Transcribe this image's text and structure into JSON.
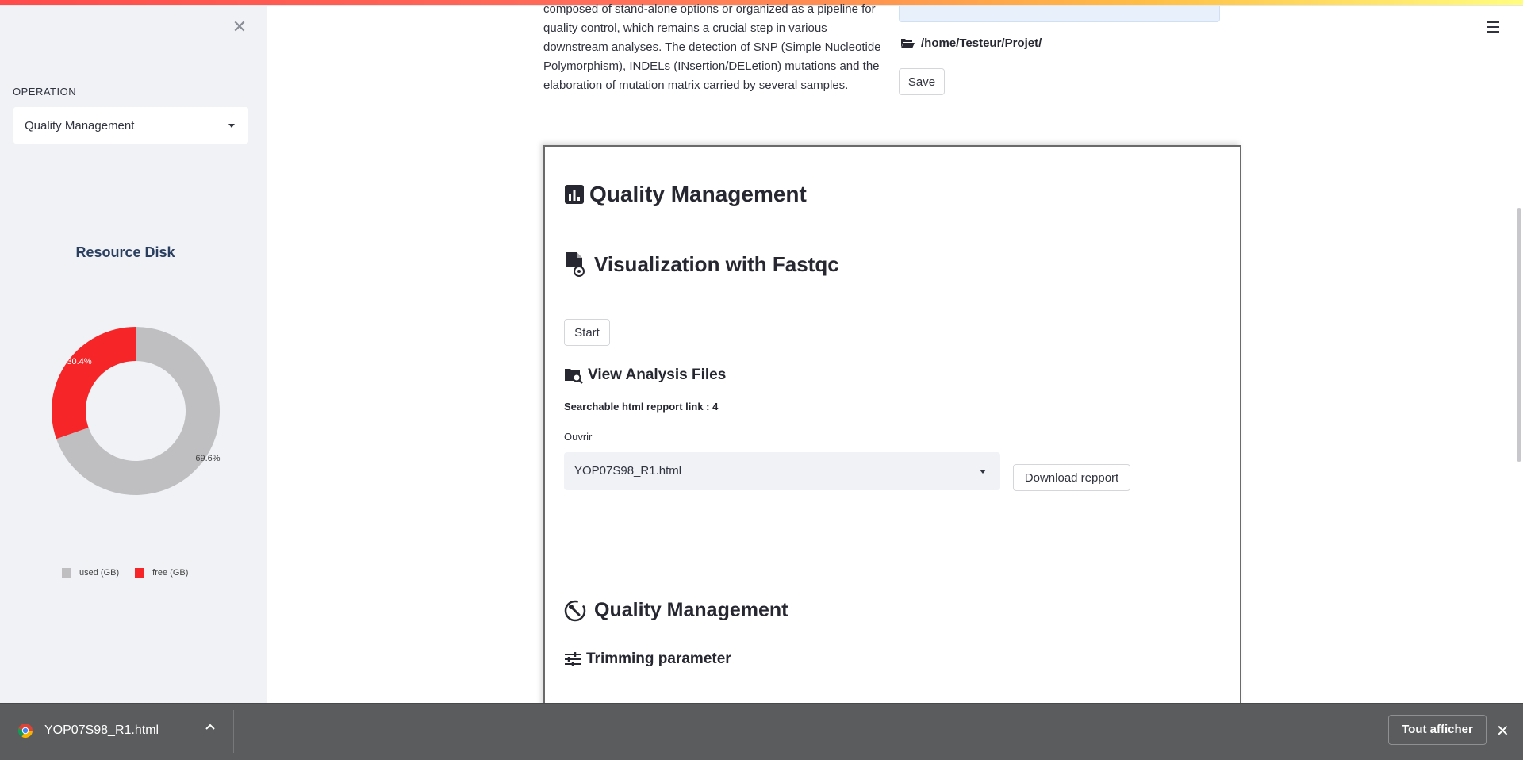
{
  "sidebar": {
    "operation_label": "OPERATION",
    "operation_value": "Quality Management",
    "chart_title": "Resource Disk"
  },
  "chart_data": {
    "type": "pie",
    "title": "Resource Disk",
    "hole": true,
    "labels": [
      "used (GB)",
      "free (GB)"
    ],
    "values": [
      69.6,
      30.4
    ],
    "percent_labels": [
      "69.6%",
      "30.4%"
    ],
    "colors": [
      "#bfbfc1",
      "#f52528"
    ],
    "legend_position": "bottom"
  },
  "main": {
    "intro_lines": [
      "composed of stand-alone options or organized as a pipeline for",
      "quality control, which remains a crucial step in various",
      "downstream analyses. The detection of SNP (Simple Nucleotide",
      "Polymorphism), INDELs (INsertion/DELetion) mutations and the",
      "elaboration of mutation matrix carried by several samples."
    ],
    "path": "/home/Testeur/Projet/",
    "save_label": "Save",
    "section_title": "Quality Management",
    "fastqc_title": "Visualization with Fastqc",
    "start_label": "Start",
    "view_files_title": "View Analysis Files",
    "report_link_text": "Searchable html repport link : 4",
    "open_label": "Ouvrir",
    "file_select_value": "YOP07S98_R1.html",
    "download_label": "Download repport",
    "qm_title": "Quality Management",
    "trimming_title": "Trimming parameter"
  },
  "download_bar": {
    "file_name": "YOP07S98_R1.html",
    "show_all_label": "Tout afficher",
    "close_glyph": "✕"
  },
  "sidebar_close_glyph": "✕"
}
